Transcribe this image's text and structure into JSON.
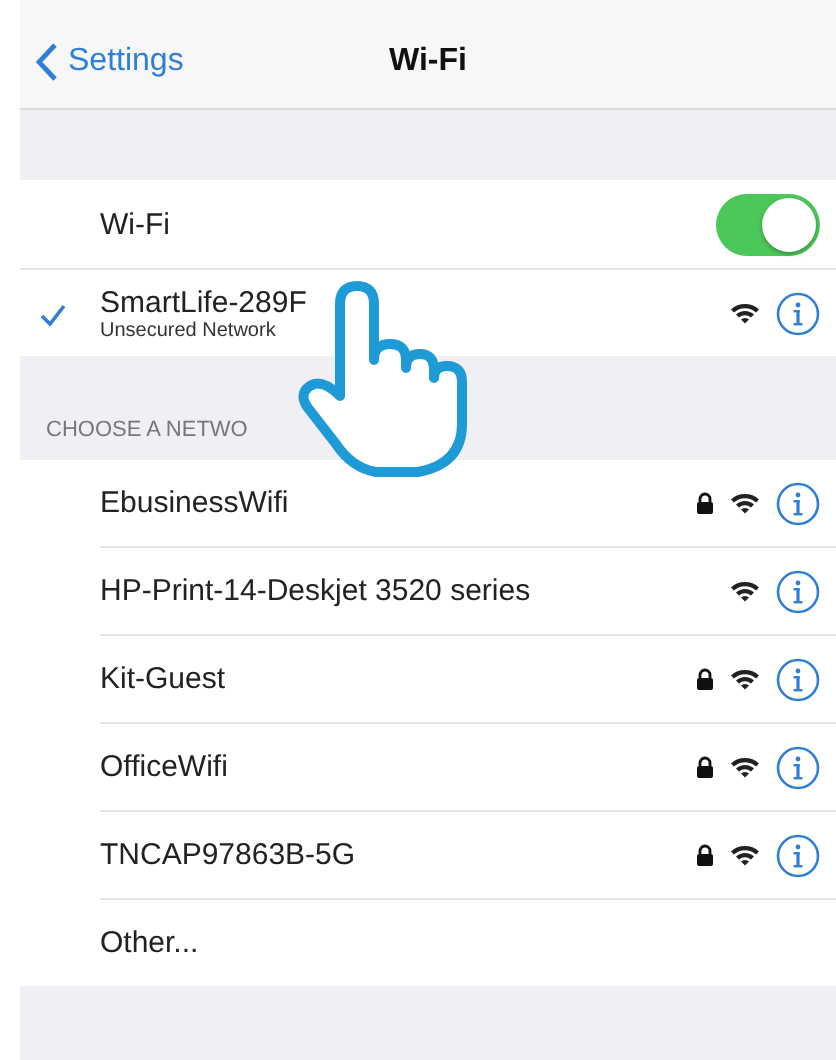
{
  "nav": {
    "back": "Settings",
    "title": "Wi-Fi"
  },
  "wifi_switch": {
    "label": "Wi-Fi",
    "on": true
  },
  "connected": {
    "name": "SmartLife-289F",
    "subtitle": "Unsecured Network",
    "selected": true,
    "locked": false
  },
  "section_header": "CHOOSE A NETWO",
  "networks": [
    {
      "name": "EbusinessWifi",
      "locked": true
    },
    {
      "name": "HP-Print-14-Deskjet 3520 series",
      "locked": false
    },
    {
      "name": "Kit-Guest",
      "locked": true
    },
    {
      "name": "OfficeWifi",
      "locked": true
    },
    {
      "name": "TNCAP97863B-5G",
      "locked": true
    }
  ],
  "other": "Other..."
}
